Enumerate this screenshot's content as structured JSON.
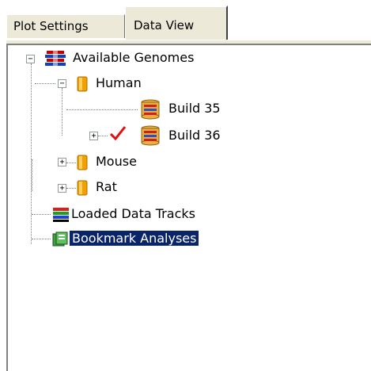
{
  "tabs": [
    {
      "label": "Plot Settings",
      "active": false
    },
    {
      "label": "Data View",
      "active": true
    }
  ],
  "tree": {
    "root": {
      "label": "Available Genomes",
      "icon": "genome-icon"
    },
    "human": {
      "label": "Human",
      "icon": "folder-icon"
    },
    "build35": {
      "label": "Build 35",
      "icon": "database-icon"
    },
    "build36": {
      "label": "Build 36",
      "icon": "database-icon",
      "checked": true
    },
    "mouse": {
      "label": "Mouse",
      "icon": "folder-icon"
    },
    "rat": {
      "label": "Rat",
      "icon": "folder-icon"
    },
    "loaded": {
      "label": "Loaded Data Tracks",
      "icon": "tracks-icon"
    },
    "bookmarks": {
      "label": "Bookmark Analyses",
      "icon": "bookmark-icon",
      "selected": true
    }
  },
  "colors": {
    "selection": "#0a246a",
    "check": "#e01010",
    "folder": "#f0a000"
  }
}
